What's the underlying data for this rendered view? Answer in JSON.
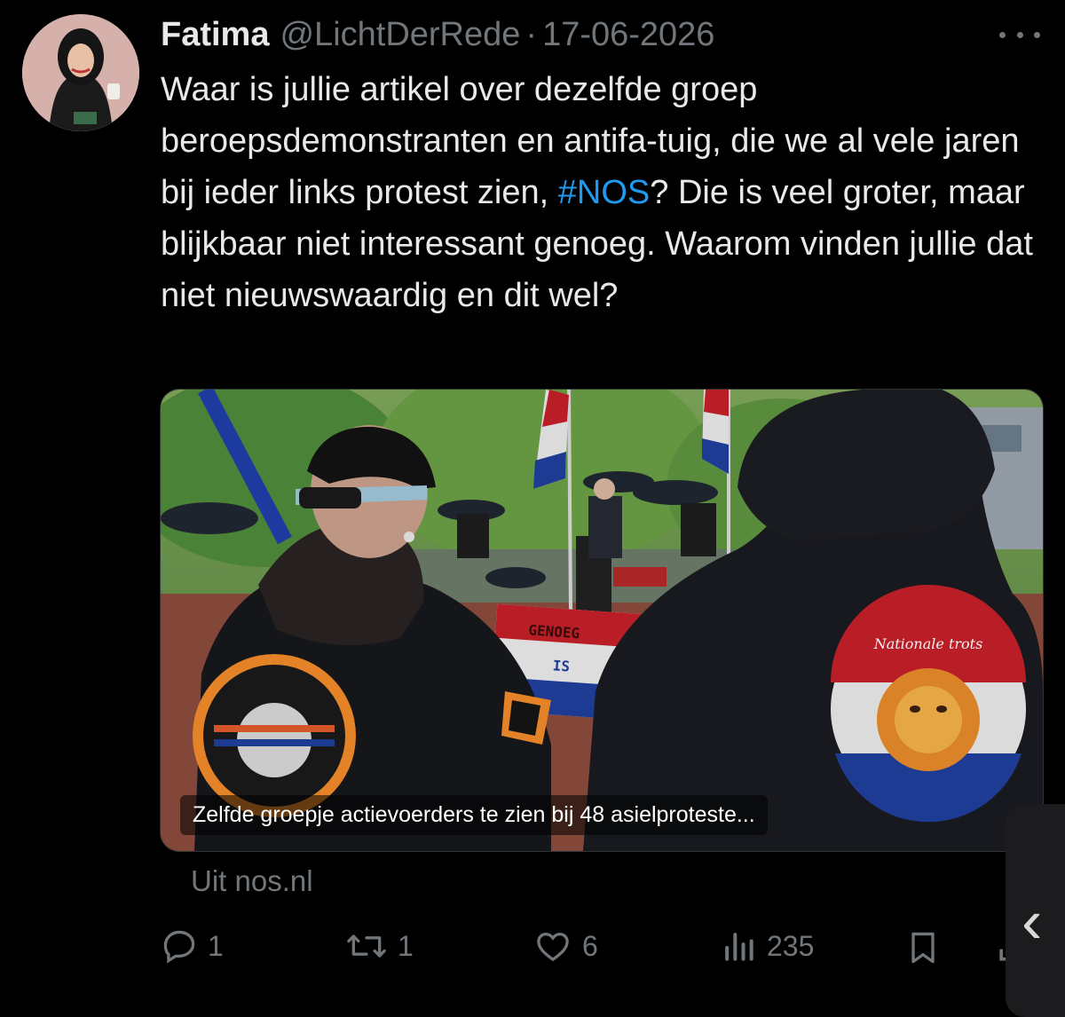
{
  "tweet": {
    "author_name": "Fatima",
    "handle": "@LichtDerRede",
    "separator": "·",
    "date": "17-06-2026",
    "text_before_hashtag": "Waar is jullie artikel over dezelfde groep beroepsdemonstranten en antifa-tuig, die we al vele jaren bij ieder links protest zien, ",
    "hashtag": "#NOS",
    "text_after_hashtag": "? Die is veel groter, maar blijkbaar niet interessant genoeg. Waarom vinden jullie dat niet nieuwswaardig en dit wel?"
  },
  "card": {
    "caption": "Zelfde groepje actievoerders te zien bij 48 asielproteste...",
    "banner_line1": "GENOEG",
    "banner_line2": "IS",
    "patch_text": "Nationale trots",
    "source": "Uit nos.nl"
  },
  "actions": {
    "replies": "1",
    "reposts": "1",
    "likes": "6",
    "views": "235"
  },
  "icons": [
    "more-icon",
    "reply-icon",
    "repost-icon",
    "like-icon",
    "views-icon",
    "bookmark-icon",
    "share-icon",
    "chevron-left-icon"
  ],
  "colors": {
    "background": "#000000",
    "text": "#e7e9ea",
    "muted": "#71767b",
    "accent": "#1d9bf0"
  }
}
